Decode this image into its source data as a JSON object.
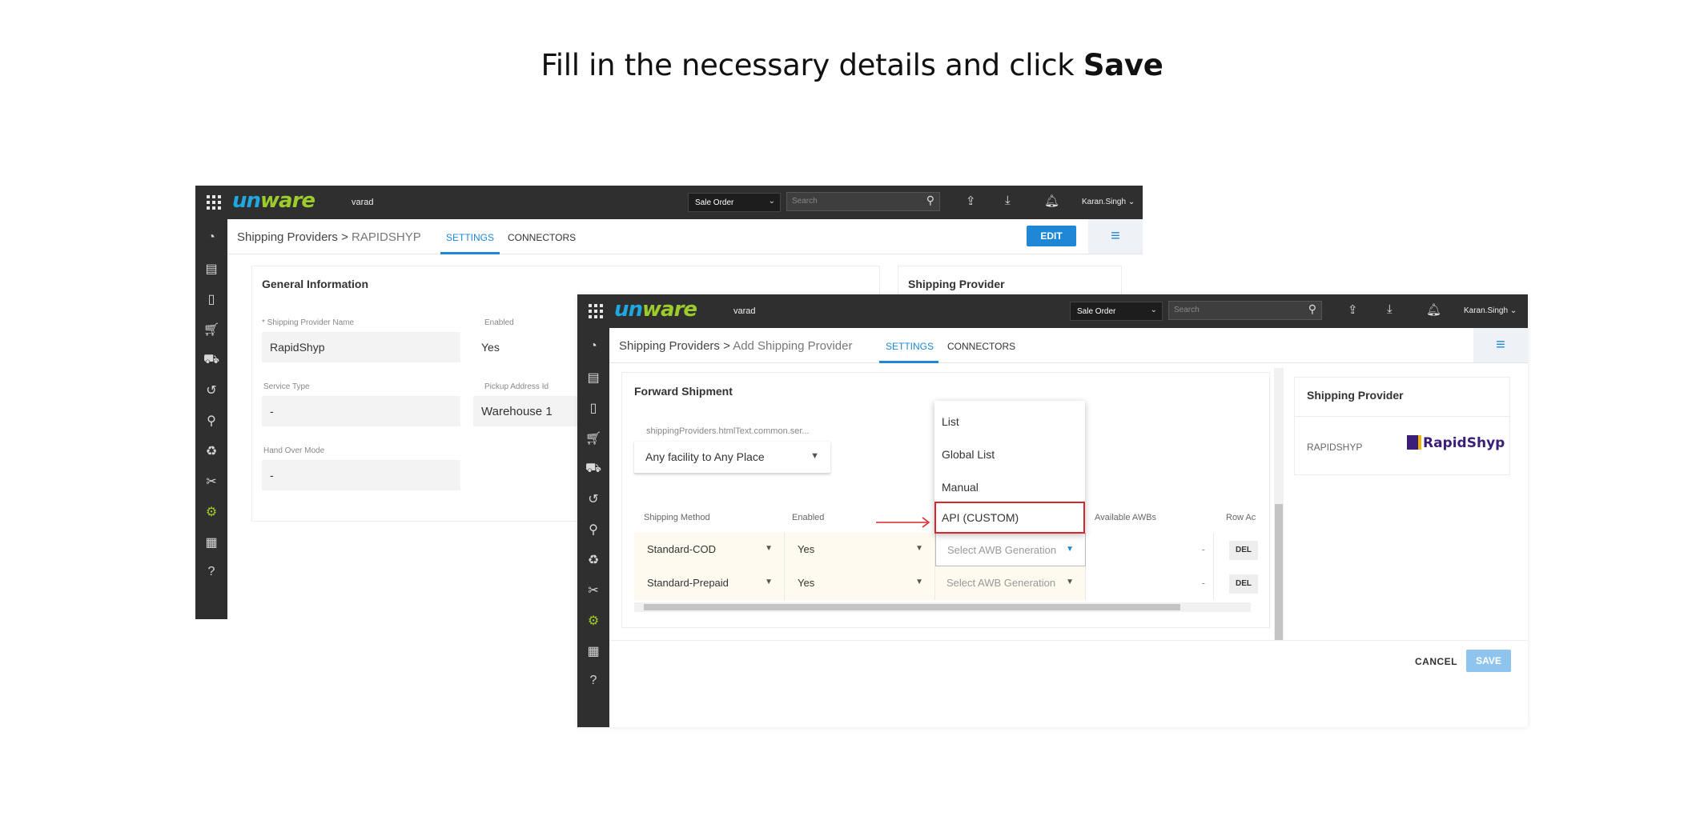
{
  "instruction": {
    "text": "Fill in the necessary details and click ",
    "bold": "Save"
  },
  "back_window": {
    "logo": {
      "u": "un",
      "w": "ware"
    },
    "tenant": "varad",
    "order_select": "Sale Order",
    "search_placeholder": "Search",
    "user": "Karan.Singh",
    "breadcrumb": {
      "parent": "Shipping Providers",
      "sep": ">",
      "current": "RAPIDSHYP"
    },
    "tabs": [
      "SETTINGS",
      "CONNECTORS"
    ],
    "edit_label": "EDIT",
    "general_title": "General Information",
    "right_title": "Shipping Provider",
    "fields": {
      "name_label": "* Shipping Provider Name",
      "name_value": "RapidShyp",
      "enabled_label": "Enabled",
      "enabled_value": "Yes",
      "service_label": "Service Type",
      "service_value": "-",
      "pickup_label": "Pickup Address Id",
      "pickup_value": "Warehouse 1",
      "handover_label": "Hand Over Mode",
      "handover_value": "-"
    }
  },
  "front_window": {
    "logo": {
      "u": "un",
      "w": "ware"
    },
    "tenant": "varad",
    "order_select": "Sale Order",
    "search_placeholder": "Search",
    "user": "Karan.Singh",
    "breadcrumb": {
      "parent": "Shipping Providers",
      "sep": ">",
      "current": "Add Shipping Provider"
    },
    "tabs": [
      "SETTINGS",
      "CONNECTORS"
    ],
    "forward_title": "Forward Shipment",
    "facility_label": "shippingProviders.htmlText.common.ser...",
    "facility_value": "Any facility to Any Place",
    "table": {
      "headers": [
        "Shipping Method",
        "Enabled",
        "Available AWBs",
        "Row Ac"
      ],
      "rows": [
        {
          "method": "Standard-COD",
          "enabled": "Yes",
          "awb": "Select AWB Generation",
          "available": "-",
          "action": "DEL"
        },
        {
          "method": "Standard-Prepaid",
          "enabled": "Yes",
          "awb": "Select AWB Generation",
          "available": "-",
          "action": "DEL"
        }
      ]
    },
    "popup_options": [
      "List",
      "Global List",
      "Manual",
      "API (CUSTOM)"
    ],
    "provider_panel": {
      "title": "Shipping Provider",
      "name": "RAPIDSHYP",
      "logo_text": "RapidShyp"
    },
    "cancel_label": "CANCEL",
    "save_label": "SAVE"
  },
  "colors": {
    "accent": "#1e88d6",
    "topbar": "#2f2f2f",
    "highlight": "#d8262c",
    "brand_green": "#9ccc2c",
    "brand_blue": "#1fa7e0"
  }
}
